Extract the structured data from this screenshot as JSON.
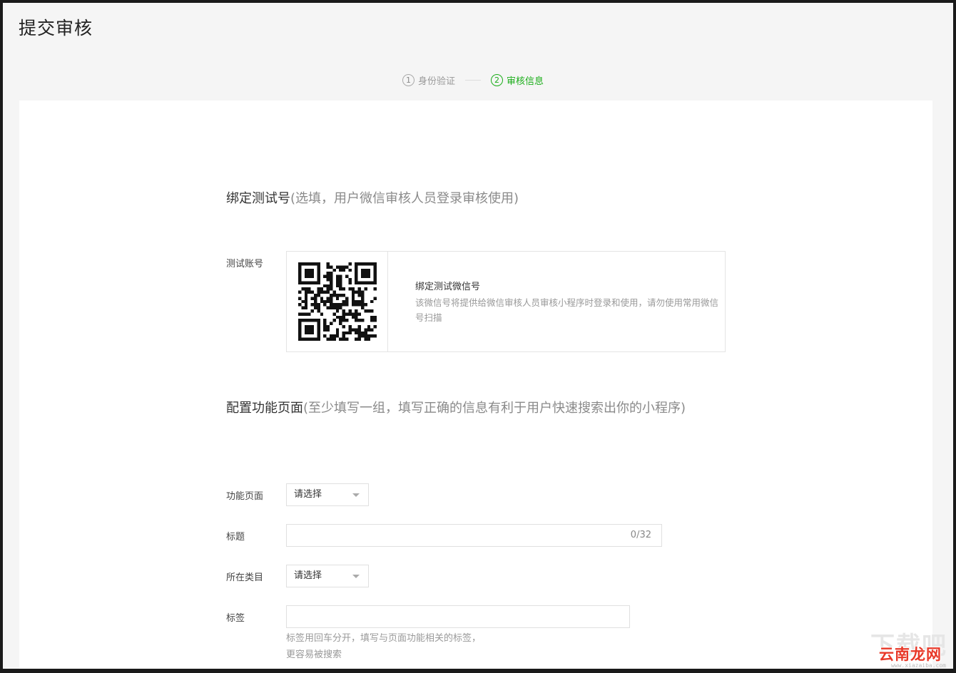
{
  "page": {
    "title": "提交审核"
  },
  "steps": [
    {
      "num": "1",
      "label": "身份验证",
      "active": false
    },
    {
      "num": "2",
      "label": "审核信息",
      "active": true
    }
  ],
  "bind_section": {
    "title": "绑定测试号",
    "hint": "(选填，用户微信审核人员登录审核使用)",
    "account_label": "测试账号",
    "qr_title": "绑定测试微信号",
    "qr_desc": "该微信号将提供给微信审核人员审核小程序时登录和使用，请勿使用常用微信号扫描"
  },
  "config_section": {
    "title": "配置功能页面",
    "hint": "(至少填写一组，填写正确的信息有利于用户快速搜索出你的小程序)",
    "page_label": "功能页面",
    "page_select": "请选择",
    "title_label": "标题",
    "title_value": "",
    "title_counter": "0/32",
    "category_label": "所在类目",
    "category_select": "请选择",
    "tags_label": "标签",
    "tags_value": "",
    "tags_help_1": "标签用回车分开，填写与页面功能相关的标签，",
    "tags_help_2": "更容易被搜索"
  },
  "watermark": {
    "big": "下载吧",
    "brand": "云南龙网",
    "url": "www.xiazaiba.com"
  },
  "colors": {
    "accent": "#1aad19",
    "border": "#e4e4e4",
    "hint": "#999999"
  },
  "icons": {
    "qr": "qr-code-icon",
    "caret": "chevron-down-icon"
  }
}
